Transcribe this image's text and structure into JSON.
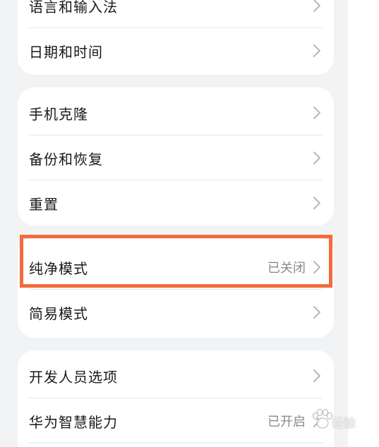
{
  "groups": [
    {
      "items": [
        {
          "label": "语言和输入法"
        },
        {
          "label": "日期和时间"
        }
      ]
    },
    {
      "items": [
        {
          "label": "手机克隆"
        },
        {
          "label": "备份和恢复"
        },
        {
          "label": "重置"
        }
      ]
    },
    {
      "items": [
        {
          "label": "纯净模式",
          "value": "已关闭"
        },
        {
          "label": "简易模式"
        }
      ]
    },
    {
      "items": [
        {
          "label": "开发人员选项"
        },
        {
          "label": "华为智慧能力",
          "value": "已开启"
        }
      ]
    }
  ],
  "annotation": {
    "highlight_color": "#f46a3a"
  },
  "watermark": {
    "text": "经验"
  },
  "icons": {
    "chevron": "chevron-right-icon",
    "watermark": "paw-icon"
  }
}
